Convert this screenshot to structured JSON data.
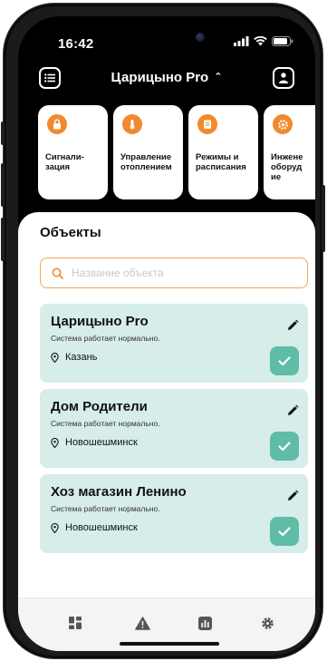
{
  "status_bar": {
    "time": "16:42",
    "icons": [
      "signal-icon",
      "wifi-icon",
      "battery-icon"
    ]
  },
  "header": {
    "menu_icon": "list-icon",
    "title": "Царицыно Pro",
    "dropdown_icon": "chevron-up-icon",
    "profile_icon": "user-icon"
  },
  "categories": [
    {
      "label": "Сигнали-\nзация",
      "icon": "lock-icon"
    },
    {
      "label": "Управление\nотоплением",
      "icon": "thermometer-icon"
    },
    {
      "label": "Режимы и\nрасписания",
      "icon": "schedule-icon"
    },
    {
      "label": "Инжене\nоборуд\nие",
      "icon": "gear-icon"
    }
  ],
  "objects_section": {
    "title": "Объекты",
    "search": {
      "placeholder": "Название объекта",
      "value": ""
    },
    "items": [
      {
        "name": "Царицыно Pro",
        "status": "Система работает нормально.",
        "location": "Казань"
      },
      {
        "name": "Дом Родители",
        "status": "Система работает нормально.",
        "location": "Новошешминск"
      },
      {
        "name": "Хоз магазин Ленино",
        "status": "Система работает нормально.",
        "location": "Новошешминск"
      }
    ]
  },
  "tab_bar": {
    "tabs": [
      "dashboard-icon",
      "alert-icon",
      "stats-icon",
      "settings-icon"
    ]
  },
  "colors": {
    "accent_orange": "#f08a2e",
    "card_bg": "#d6ede9",
    "check_green": "#5fbca7",
    "dark_bg": "#000000"
  }
}
